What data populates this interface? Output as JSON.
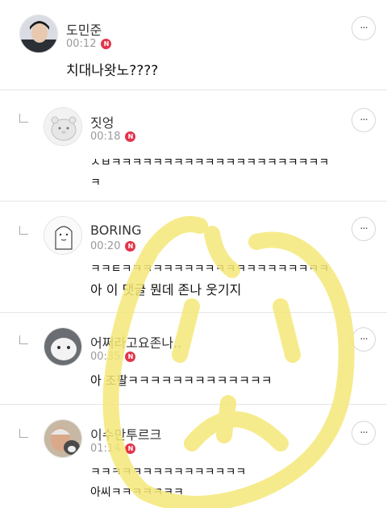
{
  "comments": [
    {
      "name": "도민준",
      "time": "00:12",
      "badge": "N",
      "lines": [
        "치대나왓노????"
      ]
    },
    {
      "name": "짓엉",
      "time": "00:18",
      "badge": "N",
      "lines": [
        "ㅅㅂㅋㅋㅋㅋㅋㅋㅋㅋㅋㅋㅋㅋㅋㅋㅋㅋㅋㅋㅋㅋㅋ",
        "ㅋ"
      ]
    },
    {
      "name": "BORING",
      "time": "00:20",
      "badge": "N",
      "lines": [
        "ㅋㅋㅌㅋㅋㅋㅋㅋㅋㅋㅋㅋㅋㅋㅋㅋㅋㅋㅋㅋㅋㅋㅋ",
        "아 이 댓글 뭔데 존나 웃기지"
      ]
    },
    {
      "name": "어쩌라고요존나..",
      "time": "00:35",
      "badge": "N",
      "lines": [
        "아 조팔ㅋㅋㅋㅋㅋㅋㅋㅋㅋㅋㅋㅋㅋ"
      ]
    },
    {
      "name": "이수만투르크",
      "time": "01:14",
      "badge": "N",
      "lines": [
        "ㅋㅋㅋㅋㅋㅋㅋㅋㅋㅋㅋㅋㅋㅋㅋ",
        "아씨ㅋㅋㅋㅋㅋㅋㅋ"
      ]
    }
  ],
  "more_icon": "more-horizontal-icon",
  "more_label": "···",
  "colors": {
    "new_badge": "#e2344a",
    "watermark": "#f5e878"
  }
}
